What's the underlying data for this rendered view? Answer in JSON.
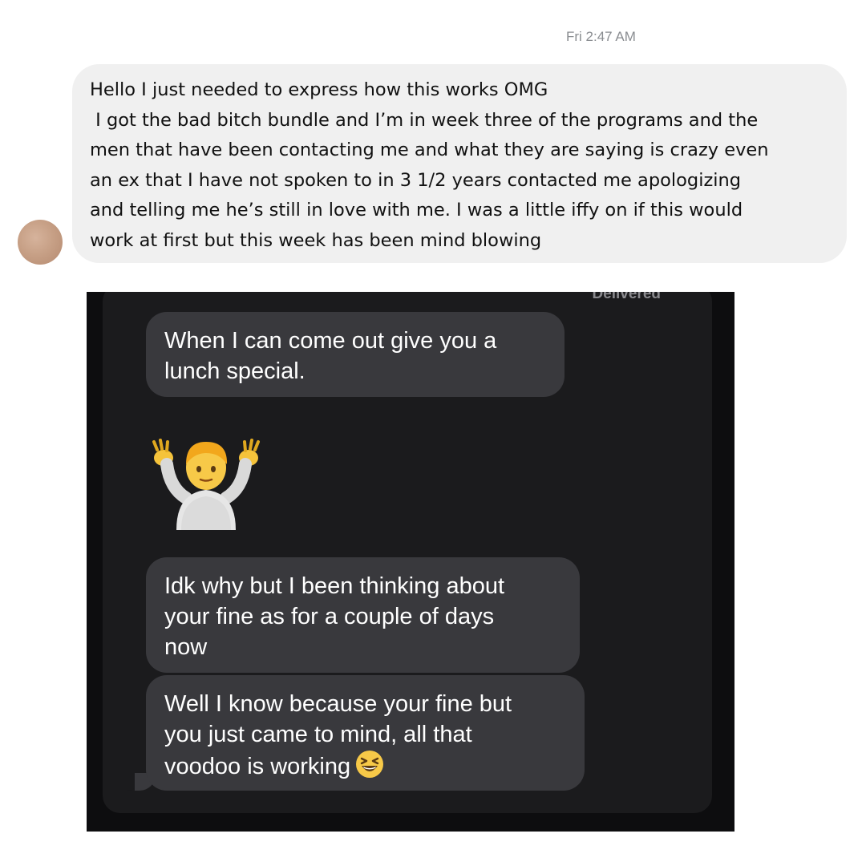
{
  "header": {
    "timestamp": "Fri 2:47 AM"
  },
  "message": {
    "lines": [
      "Hello I just needed to express how this works OMG",
      " I got the bad bitch bundle and I’m in week three of the programs and the",
      "men that have been contacting me and what they are saying is crazy even",
      "an ex that I have not spoken to in 3 1/2 years contacted me apologizing",
      "and telling me he’s still in love with me. I was a little iffy on if this would",
      "work at first but this week has been mind blowing"
    ]
  },
  "screenshot": {
    "status": "Delivered",
    "bubbles": [
      {
        "lines": [
          "When I can come out give you a",
          "lunch special."
        ]
      },
      {
        "lines": [
          "Idk why but I been thinking about",
          "your fine as for a couple of days",
          "now"
        ]
      },
      {
        "lines": [
          "Well I know because your fine but",
          "you just came to mind, all that",
          "voodoo is working"
        ]
      }
    ],
    "emoji": {
      "shrug": "person-shrugging-emoji",
      "laugh": "grinning-squinting-face-emoji"
    }
  },
  "colors": {
    "bubble_light": "#f0f0f0",
    "bubble_dark": "#39393d",
    "screenshot_bg": "#1b1b1d"
  }
}
